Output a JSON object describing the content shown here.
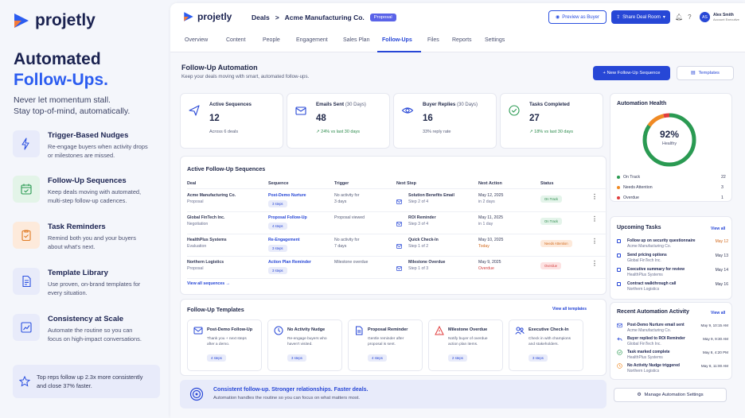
{
  "brand": {
    "name": "projetly"
  },
  "hero": {
    "line1": "Automated",
    "line2": "Follow-Ups.",
    "sub1": "Never let momentum stall.",
    "sub2": "Stay top-of-mind, automatically."
  },
  "features": [
    {
      "title": "Trigger-Based Nudges",
      "desc1": "Re-engage buyers when activity drops",
      "desc2": "or milestones are missed.",
      "icon": "lightning-icon",
      "color": "#e8ebfa"
    },
    {
      "title": "Follow-Up Sequences",
      "desc1": "Keep deals moving with automated,",
      "desc2": "multi-step follow-up cadences.",
      "icon": "calendar-icon",
      "color": "#e3f4e8"
    },
    {
      "title": "Task Reminders",
      "desc1": "Remind both you and your buyers",
      "desc2": "about what's next.",
      "icon": "clipboard-icon",
      "color": "#fdeadb"
    },
    {
      "title": "Template Library",
      "desc1": "Use proven, on-brand templates for",
      "desc2": "every situation.",
      "icon": "document-icon",
      "color": "#e8ebfa"
    },
    {
      "title": "Consistency at Scale",
      "desc1": "Automate the routine so you can",
      "desc2": "focus on high-impact conversations.",
      "icon": "chart-icon",
      "color": "#e8ebfa"
    }
  ],
  "quote": {
    "line1": "Top reps follow up 2.3x more consistently",
    "line2": "and close 37% faster."
  },
  "topbar": {
    "deals": "Deals",
    "separator": ">",
    "deal_name": "Acme Manufacturing Co.",
    "badge": "Proposal",
    "preview": "Preview as Buyer",
    "share": "Share Deal Room",
    "user_initials": "AS",
    "user_name": "Alex Smith",
    "user_role": "Account Executive"
  },
  "tabs": [
    "Overview",
    "Content",
    "People",
    "Engagement",
    "Sales Plan",
    "Follow-Ups",
    "Files",
    "Reports",
    "Settings"
  ],
  "page": {
    "title": "Follow-Up Automation",
    "subtitle": "Keep your deals moving with smart, automated follow-ups.",
    "new_btn": "+ New Follow-Up Sequence",
    "templates_btn": "Templates"
  },
  "stats": [
    {
      "label": "Active Sequences",
      "label_sub": "",
      "value": "12",
      "note": "Across 6 deals",
      "green": false
    },
    {
      "label": "Emails Sent",
      "label_sub": "(30 Days)",
      "value": "48",
      "note": "↗ 24% vs last 30 days",
      "green": true
    },
    {
      "label": "Buyer Replies",
      "label_sub": "(30 Days)",
      "value": "16",
      "note": "33% reply rate",
      "green": false
    },
    {
      "label": "Tasks Completed",
      "label_sub": "",
      "value": "27",
      "note": "↗ 18% vs last 30 days",
      "green": true
    }
  ],
  "sequences": {
    "title": "Active Follow-Up Sequences",
    "headers": [
      "Deal",
      "Sequence",
      "Trigger",
      "Next Step",
      "Next Action",
      "Status"
    ],
    "rows": [
      {
        "deal": "Acme Manufacturing Co.",
        "deal_sub": "Proposal",
        "seq": "Post-Demo Nurture",
        "steps": "3 steps",
        "trigger1": "No activity for",
        "trigger2": "3 days",
        "step": "Solution Benefits Email",
        "step_sub": "Step 2 of 4",
        "date": "May 12, 2025",
        "when": "in 2 days",
        "when_color": "#6a7090",
        "status": "On Track",
        "status_cls": "ontrack"
      },
      {
        "deal": "Global FinTech Inc.",
        "deal_sub": "Negotiation",
        "seq": "Proposal Follow-Up",
        "steps": "4 steps",
        "trigger1": "Proposal viewed",
        "trigger2": "",
        "step": "ROI Reminder",
        "step_sub": "Step 3 of 4",
        "date": "May 11, 2025",
        "when": "in 1 day",
        "when_color": "#6a7090",
        "status": "On Track",
        "status_cls": "ontrack"
      },
      {
        "deal": "HealthPlus Systems",
        "deal_sub": "Evaluation",
        "seq": "Re-Engagement",
        "steps": "3 steps",
        "trigger1": "No activity for",
        "trigger2": "7 days",
        "step": "Quick Check-In",
        "step_sub": "Step 1 of 2",
        "date": "May 10, 2025",
        "when": "Today",
        "when_color": "#d26a1d",
        "status": "Needs Attention",
        "status_cls": "needs"
      },
      {
        "deal": "Northern Logistics",
        "deal_sub": "Proposal",
        "seq": "Action Plan Reminder",
        "steps": "3 steps",
        "trigger1": "Milestone overdue",
        "trigger2": "",
        "step": "Milestone Overdue",
        "step_sub": "Step 1 of 3",
        "date": "May 9, 2025",
        "when": "Overdue",
        "when_color": "#d23d3d",
        "status": "Overdue",
        "status_cls": "overdue"
      }
    ],
    "view_all": "View all sequences →"
  },
  "templates": {
    "title": "Follow-Up Templates",
    "view_all": "View all templates",
    "items": [
      {
        "title": "Post-Demo Follow-Up",
        "d1": "Thank you + next steps",
        "d2": "after a demo.",
        "steps": "4 steps",
        "icon": "mail-icon"
      },
      {
        "title": "No Activity Nudge",
        "d1": "Re-engage buyers who",
        "d2": "haven't visited.",
        "steps": "3 steps",
        "icon": "clock-icon"
      },
      {
        "title": "Proposal Reminder",
        "d1": "Gentle reminder after",
        "d2": "proposal is sent.",
        "steps": "4 steps",
        "icon": "document-icon"
      },
      {
        "title": "Milestone Overdue",
        "d1": "Notify buyer of overdue",
        "d2": "action plan items.",
        "steps": "2 steps",
        "icon": "warning-icon"
      },
      {
        "title": "Executive Check-In",
        "d1": "Check in with champions",
        "d2": "and stakeholders.",
        "steps": "3 steps",
        "icon": "people-icon"
      }
    ]
  },
  "banner": {
    "title": "Consistent follow-up. Stronger relationships. Faster deals.",
    "sub": "Automation handles the routine so you can focus on what matters most.",
    "btn": "Manage Automation Settings"
  },
  "health": {
    "title": "Automation Health",
    "value": 92,
    "value_label": "92%",
    "status": "Healthy",
    "legend": [
      {
        "label": "On Track",
        "count": "22",
        "color": "#2a9a52"
      },
      {
        "label": "Needs Attention",
        "count": "3",
        "color": "#f08a24"
      },
      {
        "label": "Overdue",
        "count": "1",
        "color": "#e03d3d"
      }
    ]
  },
  "tasks": {
    "title": "Upcoming Tasks",
    "view_all": "View all",
    "items": [
      {
        "t": "Follow up on security questionnaire",
        "s": "Acme Manufacturing Co.",
        "d": "May 12",
        "c": "#d26a1d"
      },
      {
        "t": "Send pricing options",
        "s": "Global FinTech Inc.",
        "d": "May 13",
        "c": "#303655"
      },
      {
        "t": "Executive summary for review",
        "s": "HealthPlus Systems",
        "d": "May 14",
        "c": "#303655"
      },
      {
        "t": "Contract walkthrough call",
        "s": "Northern Logistics",
        "d": "May 16",
        "c": "#303655"
      }
    ]
  },
  "activity": {
    "title": "Recent Automation Activity",
    "view_all": "View all",
    "items": [
      {
        "t": "Post-Demo Nurture email sent",
        "s": "Acme Manufacturing Co.",
        "d": "May 9, 10:15 AM",
        "icon": "mail-icon",
        "c": "#2747d6"
      },
      {
        "t": "Buyer replied to ROI Reminder",
        "s": "Global FinTech Inc.",
        "d": "May 9, 9:30 AM",
        "icon": "reply-icon",
        "c": "#2747d6"
      },
      {
        "t": "Task marked complete",
        "s": "HealthPlus Systems",
        "d": "May 8, 4:20 PM",
        "icon": "check-icon",
        "c": "#2a9a52"
      },
      {
        "t": "No Activity Nudge triggered",
        "s": "Northern Logistics",
        "d": "May 8, 11:00 AM",
        "icon": "clock-icon",
        "c": "#f08a24"
      }
    ]
  }
}
